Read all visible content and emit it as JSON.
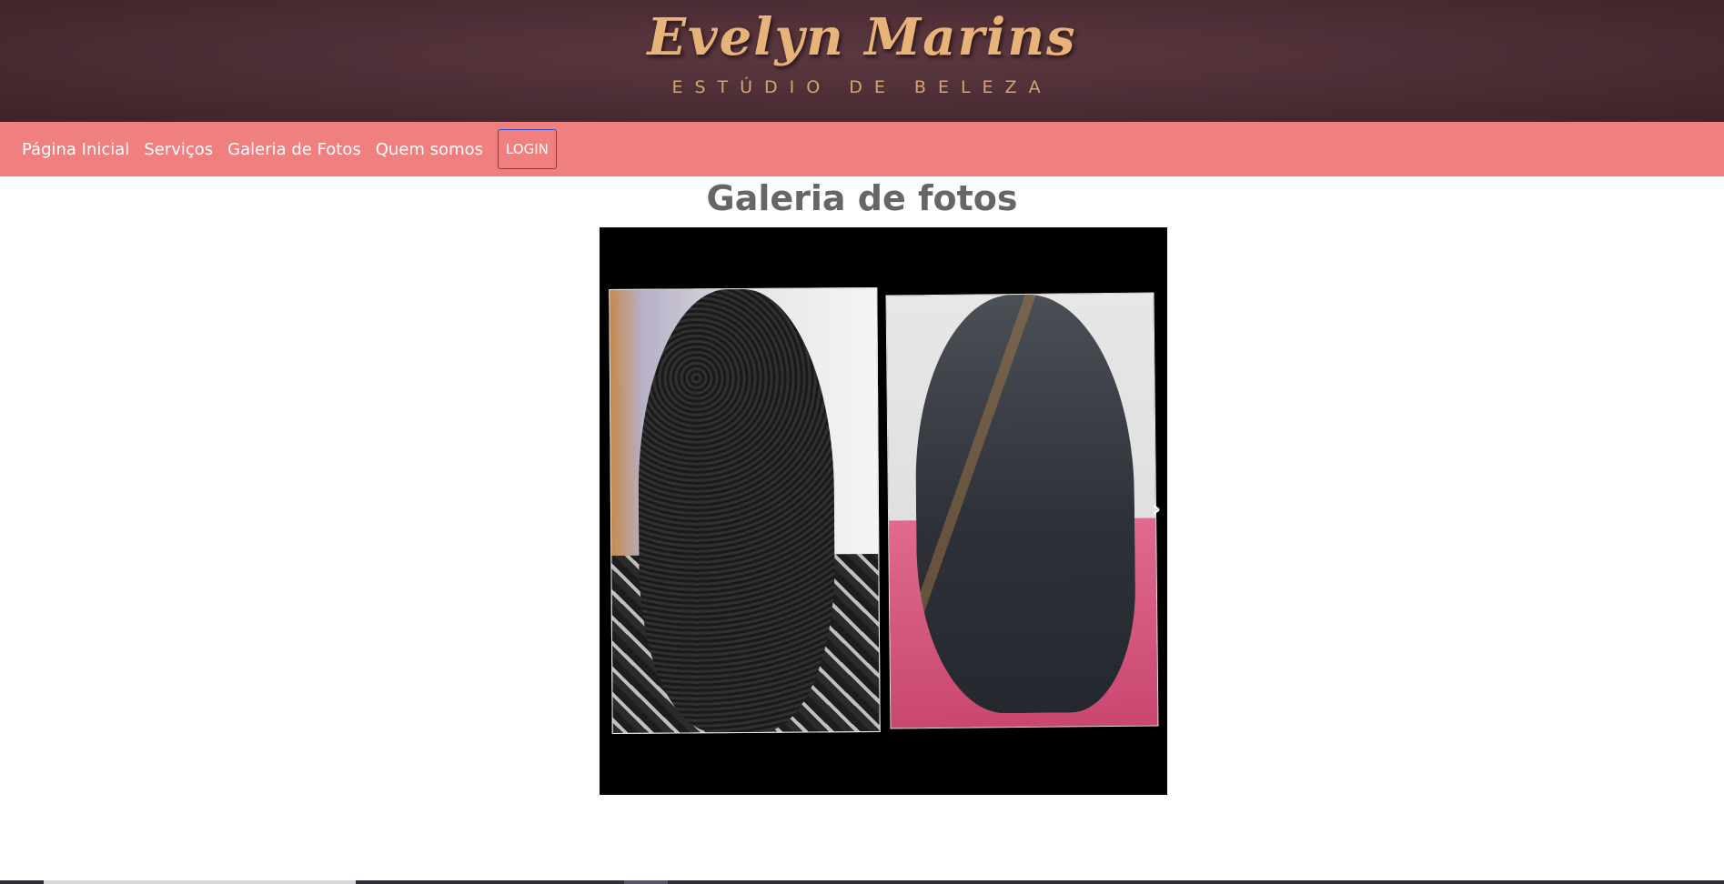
{
  "header": {
    "brand_name": "Evelyn Marins",
    "brand_subtitle": "ESTÚDIO DE BELEZA"
  },
  "navbar": {
    "items": [
      {
        "label": "Página Inicial"
      },
      {
        "label": "Serviços"
      },
      {
        "label": "Galeria de Fotos"
      },
      {
        "label": "Quem somos"
      }
    ],
    "login_label": "LOGIN"
  },
  "main": {
    "title": "Galeria de fotos"
  },
  "carousel": {
    "next_icon": "chevron-right-icon",
    "next_glyph": "›"
  },
  "colors": {
    "header_bg": "#4f2f37",
    "brand_gold": "#e8b378",
    "navbar_bg": "#f08080",
    "title_gray": "#666666",
    "login_border": "#3949c9"
  }
}
